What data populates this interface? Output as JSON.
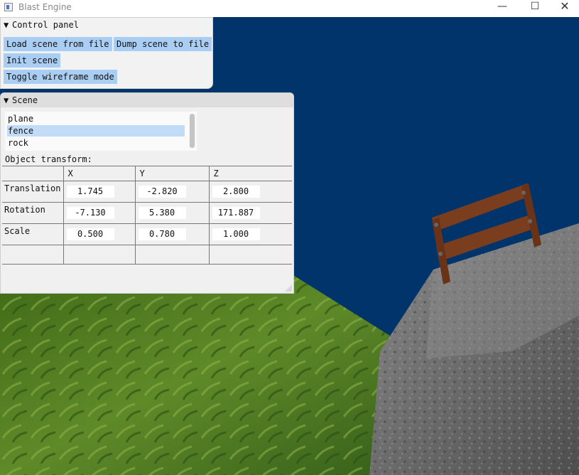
{
  "window": {
    "title": "Blast Engine",
    "minimize_glyph": "—",
    "maximize_glyph": "☐",
    "close_glyph": "✕",
    "app_icon": "app-window-icon"
  },
  "control_panel": {
    "title": "Control panel",
    "collapse_glyph": "▼",
    "buttons": {
      "load": "Load scene from file",
      "dump": "Dump scene to file",
      "init": "Init scene",
      "wireframe": "Toggle wireframe mode"
    }
  },
  "scene_panel": {
    "title": "Scene",
    "collapse_glyph": "▼",
    "objects": [
      "plane",
      "fence",
      "rock"
    ],
    "selected_object": "fence",
    "transform_label": "Object transform:",
    "columns": [
      "X",
      "Y",
      "Z"
    ],
    "rows": [
      {
        "label": "Translation",
        "values": [
          "1.745",
          "-2.820",
          "2.800"
        ]
      },
      {
        "label": "Rotation",
        "values": [
          "-7.130",
          "5.380",
          "171.887"
        ]
      },
      {
        "label": "Scale",
        "values": [
          "0.500",
          "0.780",
          "1.000"
        ]
      }
    ]
  },
  "colors": {
    "sky": "#00346a",
    "button_bg": "#a9cdf3",
    "selected_bg": "#c2dcf8",
    "grass": "#4e7a1e",
    "rock": "#6f6f6f",
    "fence": "#7a3d1d"
  }
}
